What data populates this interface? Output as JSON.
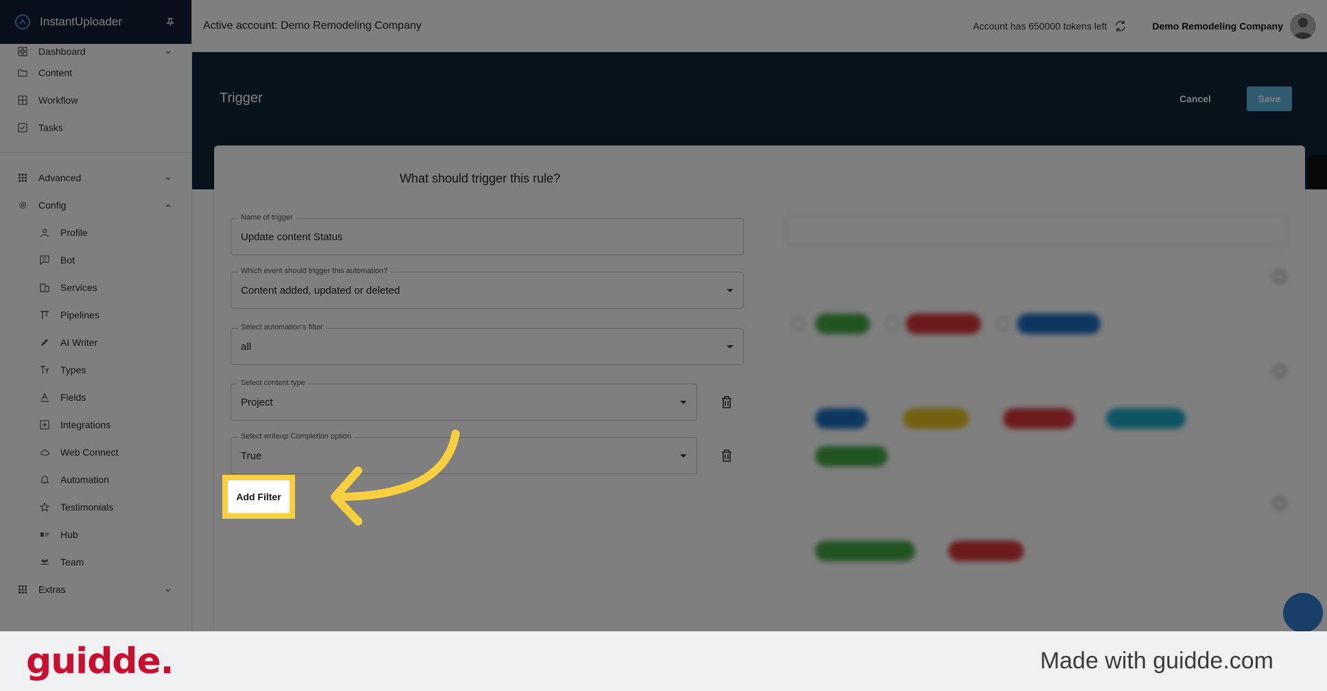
{
  "sidebar": {
    "brand": "InstantUploader",
    "items": [
      {
        "label": "Dashboard",
        "icon": "dashboard-icon",
        "chevron": "down"
      },
      {
        "label": "Content",
        "icon": "folder-icon"
      },
      {
        "label": "Workflow",
        "icon": "grid-icon"
      },
      {
        "label": "Tasks",
        "icon": "checkbox-icon"
      }
    ],
    "group_items": [
      {
        "label": "Advanced",
        "icon": "apps-icon",
        "chevron": "down"
      },
      {
        "label": "Config",
        "icon": "gear-icon",
        "chevron": "up"
      }
    ],
    "config_items": [
      {
        "label": "Profile",
        "icon": "person-icon"
      },
      {
        "label": "Bot",
        "icon": "chat-icon"
      },
      {
        "label": "Services",
        "icon": "building-icon"
      },
      {
        "label": "Pipelines",
        "icon": "pipeline-icon"
      },
      {
        "label": "AI Writer",
        "icon": "pencil-icon"
      },
      {
        "label": "Types",
        "icon": "text-icon"
      },
      {
        "label": "Fields",
        "icon": "fields-icon"
      },
      {
        "label": "Integrations",
        "icon": "plus-box-icon"
      },
      {
        "label": "Web Connect",
        "icon": "cloud-icon"
      },
      {
        "label": "Automation",
        "icon": "bell-icon"
      },
      {
        "label": "Testimonials",
        "icon": "star-icon"
      },
      {
        "label": "Hub",
        "icon": "hub-icon"
      },
      {
        "label": "Team",
        "icon": "team-icon"
      }
    ],
    "extras": {
      "label": "Extras",
      "icon": "apps-icon",
      "chevron": "down"
    }
  },
  "topbar": {
    "active_account": "Active account: Demo Remodeling Company",
    "tokens": "Account has 650000 tokens left",
    "company": "Demo Remodeling Company"
  },
  "header": {
    "title": "Trigger",
    "cancel_label": "Cancel",
    "save_label": "Save"
  },
  "form": {
    "title": "What should trigger this rule?",
    "name_label": "Name of trigger",
    "name_value": "Update content Status",
    "event_label": "Which event should trigger this automation?",
    "event_value": "Content added, updated or deleted",
    "filter_label": "Select automation's filter",
    "filter_value": "all",
    "content_type_label": "Select content type",
    "content_type_value": "Project",
    "writeup_label": "Select writeup Completion option",
    "writeup_value": "True",
    "add_filter_label": "Add Filter"
  },
  "colors": {
    "sidebar_header": "#0e2135",
    "band": "#102436",
    "save": "#5fb7e0",
    "highlight": "#f8cf3f",
    "guidde_red": "#c8102e"
  },
  "footer": {
    "logo": "guidde.",
    "made_with": "Made with guidde.com"
  }
}
